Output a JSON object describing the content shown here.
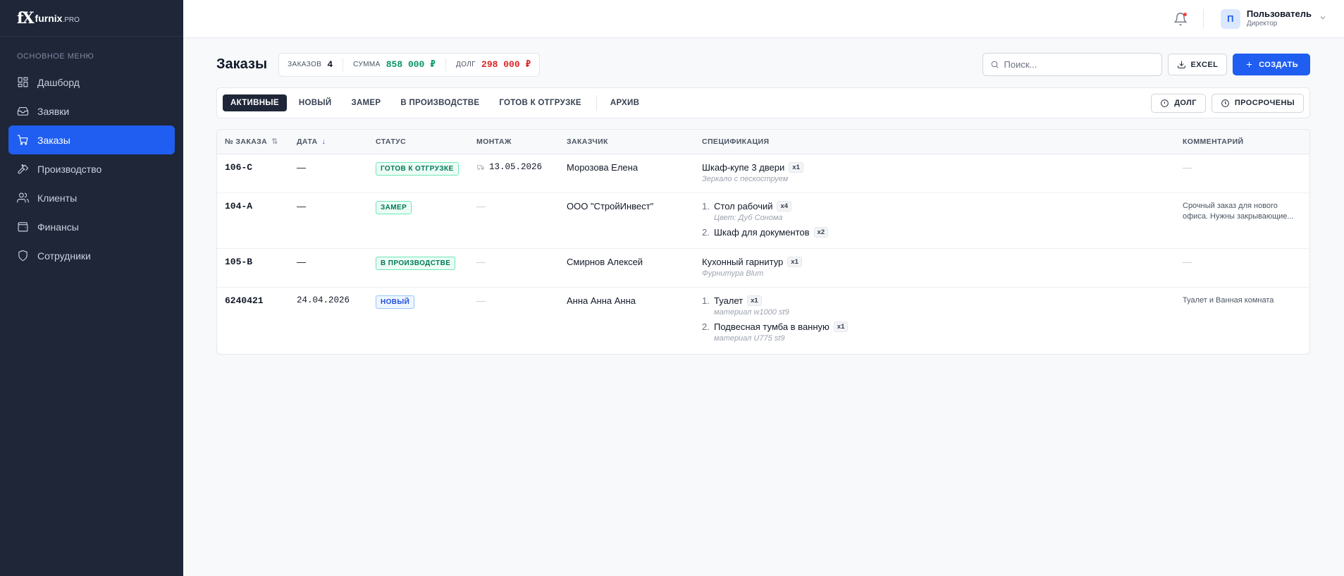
{
  "brand": {
    "mark": "fX",
    "name": "furnix",
    "suffix": ".PRO"
  },
  "sidebar": {
    "section_title": "ОСНОВНОЕ МЕНЮ",
    "items": [
      {
        "label": "Дашборд",
        "icon": "dashboard-icon"
      },
      {
        "label": "Заявки",
        "icon": "inbox-icon"
      },
      {
        "label": "Заказы",
        "icon": "cart-icon",
        "active": true
      },
      {
        "label": "Производство",
        "icon": "hammer-icon"
      },
      {
        "label": "Клиенты",
        "icon": "users-icon"
      },
      {
        "label": "Финансы",
        "icon": "wallet-icon"
      },
      {
        "label": "Сотрудники",
        "icon": "shield-icon"
      }
    ]
  },
  "user": {
    "initial": "П",
    "name": "Пользователь",
    "role": "Директор"
  },
  "page": {
    "title": "Заказы",
    "stats": {
      "orders_label": "ЗАКАЗОВ",
      "orders_value": "4",
      "sum_label": "СУММА",
      "sum_value": "858 000 ₽",
      "debt_label": "ДОЛГ",
      "debt_value": "298 000 ₽"
    },
    "search_placeholder": "Поиск...",
    "excel_label": "EXCEL",
    "create_label": "СОЗДАТЬ"
  },
  "tabs": [
    "АКТИВНЫЕ",
    "НОВЫЙ",
    "ЗАМЕР",
    "В ПРОИЗВОДСТВЕ",
    "ГОТОВ К ОТГРУЗКЕ",
    "АРХИВ"
  ],
  "filters": {
    "debt_label": "ДОЛГ",
    "overdue_label": "ПРОСРОЧЕНЫ"
  },
  "table": {
    "headers": [
      "№ ЗАКАЗА",
      "ДАТА",
      "СТАТУС",
      "МОНТАЖ",
      "ЗАКАЗЧИК",
      "СПЕЦИФИКАЦИЯ",
      "КОММЕНТАРИЙ"
    ],
    "rows": [
      {
        "number": "106-С",
        "date": "—",
        "status": "ГОТОВ К ОТГРУЗКЕ",
        "mount": "13.05.2026",
        "customer": "Морозова Елена",
        "spec": [
          {
            "name": "Шкаф-купе 3 двери",
            "qty": "x1",
            "note": "Зеркало с пескоструем"
          }
        ],
        "comment": "—"
      },
      {
        "number": "104-А",
        "date": "—",
        "status": "ЗАМЕР",
        "mount": "—",
        "customer": "ООО \"СтройИнвест\"",
        "spec": [
          {
            "idx": "1.",
            "name": "Стол рабочий",
            "qty": "x4",
            "note": "Цвет: Дуб Сонома"
          },
          {
            "idx": "2.",
            "name": "Шкаф для документов",
            "qty": "x2",
            "note": ""
          }
        ],
        "comment": "Срочный заказ для нового офиса. Нужны закрывающие..."
      },
      {
        "number": "105-В",
        "date": "—",
        "status": "В ПРОИЗВОДСТВЕ",
        "mount": "—",
        "customer": "Смирнов Алексей",
        "spec": [
          {
            "name": "Кухонный гарнитур",
            "qty": "x1",
            "note": "Фурнитура Blum"
          }
        ],
        "comment": "—"
      },
      {
        "number": "6240421",
        "date": "24.04.2026",
        "status": "НОВЫЙ",
        "mount": "—",
        "customer": "Анна Анна Анна",
        "spec": [
          {
            "idx": "1.",
            "name": "Туалет",
            "qty": "x1",
            "note": "материал w1000 st9"
          },
          {
            "idx": "2.",
            "name": "Подвесная тумба в ванную",
            "qty": "x1",
            "note": "материал U775 st9"
          }
        ],
        "comment": "Туалет и Ванная комната"
      }
    ]
  },
  "colors": {
    "accent": "#1f5ef0",
    "sidebar_bg": "#1e2638",
    "sum": "#059669",
    "debt": "#dc2626"
  }
}
